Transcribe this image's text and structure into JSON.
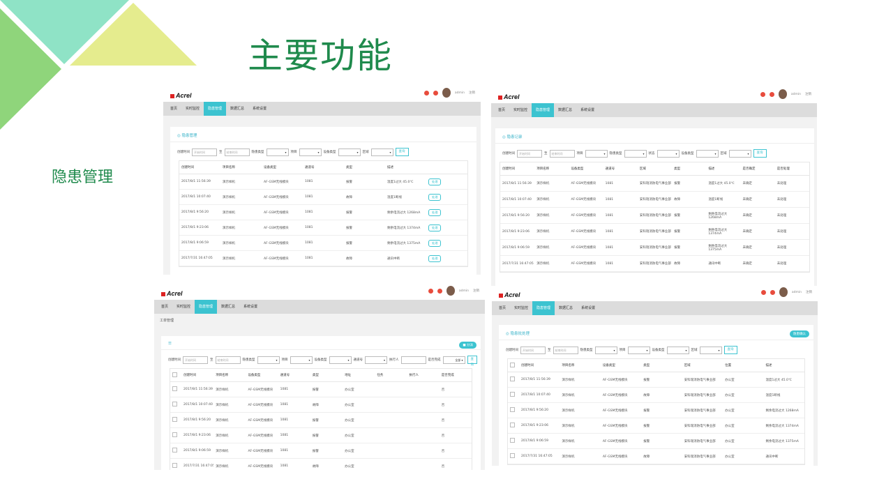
{
  "slide": {
    "title": "主要功能",
    "side_label": "隐患管理",
    "colors": {
      "title": "#1f8a4c",
      "accent": "#3cc3d0",
      "tri_light": "#8fe3c6",
      "tri_yellow": "#e5ec8e",
      "tri_green": "#8fd57b"
    }
  },
  "common": {
    "logo": "Acrel",
    "user": "admin",
    "logout": "注销",
    "nav": [
      "首页",
      "实时监控",
      "隐患管理",
      "数据汇总",
      "系统设置"
    ],
    "filter_start_label": "创建时间",
    "filter_start_placeholder": "开始时间",
    "filter_to": "至",
    "filter_end_placeholder": "结束时间",
    "search_btn": "查询",
    "edit_btn": "处理"
  },
  "p1": {
    "card_title": "◎ 隐患管理",
    "filters": [
      "隐患类型",
      "项目",
      "设备类型",
      "区域"
    ],
    "columns": [
      "创建时间",
      "项目名称",
      "设备类型",
      "通道号",
      "类型",
      "描述",
      ""
    ],
    "rows": [
      [
        "2017/8/1 11:56:39",
        "演示样机",
        "AF-GSM无线模块",
        "1081",
        "报警",
        "温度1过大 45.0℃"
      ],
      [
        "2017/8/1 10:07:40",
        "演示样机",
        "AF-GSM无线模块",
        "1081",
        "故障",
        "温度1断线"
      ],
      [
        "2017/8/1 9:56:20",
        "演示样机",
        "AF-GSM无线模块",
        "1081",
        "报警",
        "剩余电流过大 1268mA"
      ],
      [
        "2017/8/1 9:23:06",
        "演示样机",
        "AF-GSM无线模块",
        "1081",
        "报警",
        "剩余电流过大 1374mA"
      ],
      [
        "2017/8/1 9:06:59",
        "演示样机",
        "AF-GSM无线模块",
        "1081",
        "报警",
        "剩余电流过大 1375mA"
      ],
      [
        "2017/7/31 16:47:05",
        "演示样机",
        "AF-GSM无线模块",
        "1081",
        "故障",
        "通讯中断"
      ]
    ]
  },
  "p2": {
    "card_title": "◎ 隐患记录",
    "filters": [
      "项目",
      "隐患类型",
      "状态",
      "设备类型",
      "区域"
    ],
    "columns": [
      "创建时间",
      "项目名称",
      "设备类型",
      "通道号",
      "区域",
      "类型",
      "描述",
      "是否确定",
      "是否处理"
    ],
    "rows": [
      [
        "2017/8/1 11:56:39",
        "演示样机",
        "AF-GSM无线模块",
        "1081",
        "安科瑞消防电气事业部",
        "报警",
        "温度1过大 45.0℃",
        "未确定",
        "未处理"
      ],
      [
        "2017/8/1 10:07:40",
        "演示样机",
        "AF-GSM无线模块",
        "1081",
        "安科瑞消防电气事业部",
        "故障",
        "温度1断线",
        "未确定",
        "未处理"
      ],
      [
        "2017/8/1 9:56:20",
        "演示样机",
        "AF-GSM无线模块",
        "1081",
        "安科瑞消防电气事业部",
        "报警",
        "剩余电流过大 1268mA",
        "未确定",
        "未处理"
      ],
      [
        "2017/8/1 9:23:06",
        "演示样机",
        "AF-GSM无线模块",
        "1081",
        "安科瑞消防电气事业部",
        "报警",
        "剩余电流过大 1374mA",
        "未确定",
        "未处理"
      ],
      [
        "2017/8/1 9:06:59",
        "演示样机",
        "AF-GSM无线模块",
        "1081",
        "安科瑞消防电气事业部",
        "报警",
        "剩余电流过大 1375mA",
        "未确定",
        "未处理"
      ],
      [
        "2017/7/31 16:47:05",
        "演示样机",
        "AF-GSM无线模块",
        "1081",
        "安科瑞消防电气事业部",
        "故障",
        "通讯中断",
        "未确定",
        "未处理"
      ]
    ]
  },
  "p3": {
    "crumb": "工单管理",
    "card_title": "☰",
    "head_btn": "■ 分派",
    "filters": [
      "隐患类型",
      "项目",
      "设备类型",
      "通道号",
      "执行人",
      "是否完成"
    ],
    "complete_value": "全部",
    "columns": [
      "",
      "创建时间",
      "项目名称",
      "设备类型",
      "通道号",
      "类型",
      "地址",
      "任务",
      "执行人",
      "是否完成"
    ],
    "rows": [
      [
        "2017/8/1 11:56:39",
        "演示样机",
        "AF-GSM无线模块",
        "1081",
        "报警",
        "办公室",
        "",
        "",
        "否"
      ],
      [
        "2017/8/1 10:07:40",
        "演示样机",
        "AF-GSM无线模块",
        "1081",
        "故障",
        "办公室",
        "",
        "",
        "否"
      ],
      [
        "2017/8/1 9:56:20",
        "演示样机",
        "AF-GSM无线模块",
        "1081",
        "报警",
        "办公室",
        "",
        "",
        "否"
      ],
      [
        "2017/8/1 9:23:06",
        "演示样机",
        "AF-GSM无线模块",
        "1081",
        "报警",
        "办公室",
        "",
        "",
        "否"
      ],
      [
        "2017/8/1 9:06:59",
        "演示样机",
        "AF-GSM无线模块",
        "1081",
        "报警",
        "办公室",
        "",
        "",
        "否"
      ],
      [
        "2017/7/31 16:47:05",
        "演示样机",
        "AF-GSM无线模块",
        "1081",
        "故障",
        "办公室",
        "",
        "",
        "否"
      ]
    ]
  },
  "p4": {
    "card_title": "◎ 隐患批处理",
    "head_btn": "隐患确认",
    "filters": [
      "隐患类型",
      "项目",
      "设备类型",
      "区域"
    ],
    "columns": [
      "",
      "创建时间",
      "项目名称",
      "设备类型",
      "类型",
      "区域",
      "位置",
      "描述"
    ],
    "rows": [
      [
        "2017/8/1 11:56:39",
        "演示样机",
        "AF-GSM无线模块",
        "报警",
        "安科瑞消防电气事业部",
        "办公室",
        "温度1过大 45.0℃"
      ],
      [
        "2017/8/1 10:07:40",
        "演示样机",
        "AF-GSM无线模块",
        "故障",
        "安科瑞消防电气事业部",
        "办公室",
        "温度1断线"
      ],
      [
        "2017/8/1 9:56:20",
        "演示样机",
        "AF-GSM无线模块",
        "报警",
        "安科瑞消防电气事业部",
        "办公室",
        "剩余电流过大 1268mA"
      ],
      [
        "2017/8/1 9:23:06",
        "演示样机",
        "AF-GSM无线模块",
        "报警",
        "安科瑞消防电气事业部",
        "办公室",
        "剩余电流过大 1374mA"
      ],
      [
        "2017/8/1 9:06:59",
        "演示样机",
        "AF-GSM无线模块",
        "报警",
        "安科瑞消防电气事业部",
        "办公室",
        "剩余电流过大 1375mA"
      ],
      [
        "2017/7/31 16:47:05",
        "演示样机",
        "AF-GSM无线模块",
        "故障",
        "安科瑞消防电气事业部",
        "办公室",
        "通讯中断"
      ]
    ]
  }
}
